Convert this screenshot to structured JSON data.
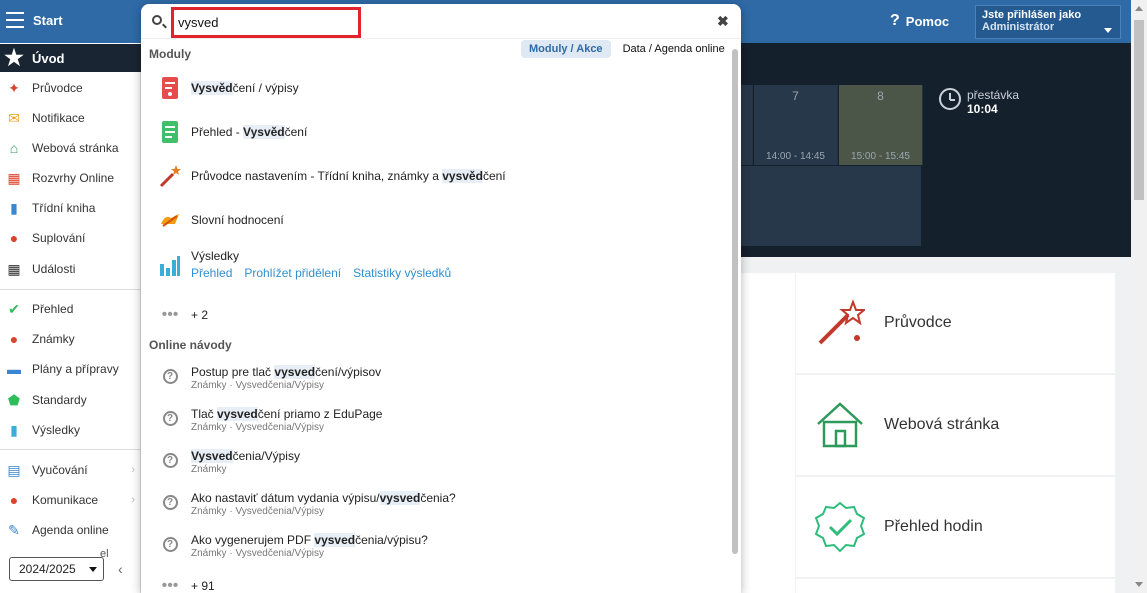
{
  "topbar": {
    "start_label": "Start",
    "help_label": "Pomoc",
    "user_line1": "Jste přihlášen jako",
    "user_line2": "Administrátor"
  },
  "sidebar": {
    "items": [
      {
        "label": "Úvod",
        "icon": "star-icon"
      },
      {
        "label": "Průvodce",
        "icon": "magic-wand-icon"
      },
      {
        "label": "Notifikace",
        "icon": "envelope-icon"
      },
      {
        "label": "Webová stránka",
        "icon": "house-icon"
      },
      {
        "label": "Rozvrhy Online",
        "icon": "timetable-icon"
      },
      {
        "label": "Třídní kniha",
        "icon": "book-icon"
      },
      {
        "label": "Suplování",
        "icon": "substitution-icon"
      },
      {
        "label": "Události",
        "icon": "calendar-icon"
      },
      {
        "label": "Přehled",
        "icon": "check-circle-icon"
      },
      {
        "label": "Známky",
        "icon": "grades-icon"
      },
      {
        "label": "Plány a přípravy",
        "icon": "briefcase-icon"
      },
      {
        "label": "Standardy",
        "icon": "shield-icon"
      },
      {
        "label": "Výsledky",
        "icon": "bar-chart-icon"
      },
      {
        "label": "Vyučování",
        "icon": "teaching-icon"
      },
      {
        "label": "Komunikace",
        "icon": "chat-icon"
      },
      {
        "label": "Agenda online",
        "icon": "pen-icon"
      }
    ],
    "partial_label": "el",
    "year": "2024/2025"
  },
  "schedule": {
    "slot7_num": "7",
    "slot7_time": "14:00 - 14:45",
    "slot8_num": "8",
    "slot8_time": "15:00 - 15:45",
    "break_label": "přestávka",
    "break_time": "10:04"
  },
  "tiles": [
    {
      "label": "Průvodce",
      "icon": "magic-wand-icon"
    },
    {
      "label": "Webová stránka",
      "icon": "house-icon"
    },
    {
      "label": "Přehled hodin",
      "icon": "check-badge-icon"
    }
  ],
  "search": {
    "query": "vysved",
    "modules_title": "Moduly",
    "tab_active": "Moduly / Akce",
    "tab_other": "Data / Agenda online",
    "modules": [
      {
        "pre": "",
        "hl": "Vysvěd",
        "post": "čení / výpisy",
        "icon": "report-card-icon"
      },
      {
        "pre": "Přehled - ",
        "hl": "Vysvěd",
        "post": "čení",
        "icon": "report-card-list-icon"
      },
      {
        "pre": "Průvodce nastavením - Třídní kniha, známky a ",
        "hl": "vysvěd",
        "post": "čení",
        "icon": "magic-wand-icon"
      },
      {
        "pre": "Slovní hodnocení",
        "hl": "",
        "post": "",
        "icon": "verbal-evaluation-icon"
      }
    ],
    "results_module": {
      "title": "Výsledky",
      "links": [
        "Přehled",
        "Prohlížet přidělení",
        "Statistiky výsledků"
      ]
    },
    "more_modules": "+ 2",
    "guides_title": "Online návody",
    "guides": [
      {
        "pre": "Postup pre tlač ",
        "hl": "vysved",
        "post": "čení/výpisov",
        "sub": "Známky · Vysvedčenia/Výpisy"
      },
      {
        "pre": "Tlač ",
        "hl": "vysved",
        "post": "čení priamo z EduPage",
        "sub": "Známky · Vysvedčenia/Výpisy"
      },
      {
        "pre": "",
        "hl": "Vysved",
        "post": "čenia/Výpisy",
        "sub": "Známky"
      },
      {
        "pre": "Ako nastaviť dátum vydania výpisu/",
        "hl": "vysved",
        "post": "čenia?",
        "sub": "Známky · Vysvedčenia/Výpisy"
      },
      {
        "pre": "Ako vygenerujem PDF ",
        "hl": "vysved",
        "post": "čenia/výpisu?",
        "sub": "Známky · Vysvedčenia/Výpisy"
      }
    ],
    "more_guides": "+ 91"
  }
}
